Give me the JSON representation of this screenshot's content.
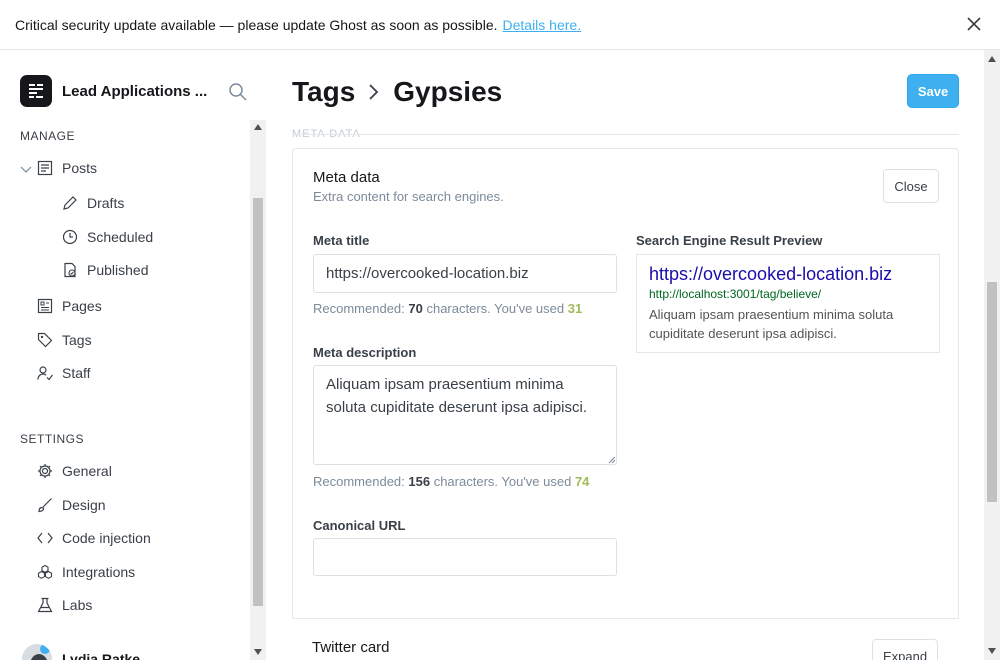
{
  "banner": {
    "message": "Critical security update available — please update Ghost as soon as possible.",
    "link": "Details here."
  },
  "sidebar": {
    "site_name": "Lead Applications ...",
    "manage_title": "MANAGE",
    "manage_items": [
      {
        "label": "Posts",
        "icon": "posts-icon"
      },
      {
        "label": "Drafts",
        "icon": "pencil-icon"
      },
      {
        "label": "Scheduled",
        "icon": "clock-icon"
      },
      {
        "label": "Published",
        "icon": "published-icon"
      },
      {
        "label": "Pages",
        "icon": "pages-icon"
      },
      {
        "label": "Tags",
        "icon": "tag-icon"
      },
      {
        "label": "Staff",
        "icon": "staff-icon"
      }
    ],
    "settings_title": "SETTINGS",
    "settings_items": [
      {
        "label": "General",
        "icon": "gear-icon"
      },
      {
        "label": "Design",
        "icon": "brush-icon"
      },
      {
        "label": "Code injection",
        "icon": "code-icon"
      },
      {
        "label": "Integrations",
        "icon": "integrations-icon"
      },
      {
        "label": "Labs",
        "icon": "flask-icon"
      }
    ],
    "user_name": "Lydia Ratke"
  },
  "header": {
    "crumb_parent": "Tags",
    "crumb_current": "Gypsies",
    "save_label": "Save"
  },
  "meta": {
    "faded_label": "META DATA",
    "title": "Meta data",
    "subtitle": "Extra content for search engines.",
    "close_label": "Close",
    "meta_title_label": "Meta title",
    "meta_title_value": "https://overcooked-location.biz",
    "meta_title_hint_prefix": "Recommended: ",
    "meta_title_recommended": "70",
    "meta_title_hint_mid": " characters. You've used ",
    "meta_title_used": "31",
    "meta_desc_label": "Meta description",
    "meta_desc_value": "Aliquam ipsam praesentium minima soluta cupiditate deserunt ipsa adipisci.",
    "meta_desc_hint_prefix": "Recommended: ",
    "meta_desc_recommended": "156",
    "meta_desc_hint_mid": " characters. You've used ",
    "meta_desc_used": "74",
    "canonical_label": "Canonical URL",
    "canonical_value": "",
    "preview_label": "Search Engine Result Preview",
    "preview_title": "https://overcooked-location.biz",
    "preview_url": "http://localhost:3001/tag/believe/",
    "preview_desc": "Aliquam ipsam praesentium minima soluta cupiditate deserunt ipsa adipisci."
  },
  "twitter": {
    "title": "Twitter card",
    "expand_label": "Expand"
  },
  "colors": {
    "accent": "#3eb0ef",
    "used_count": "#9fbb58",
    "preview_title": "#1a0dab",
    "preview_url": "#006621"
  }
}
